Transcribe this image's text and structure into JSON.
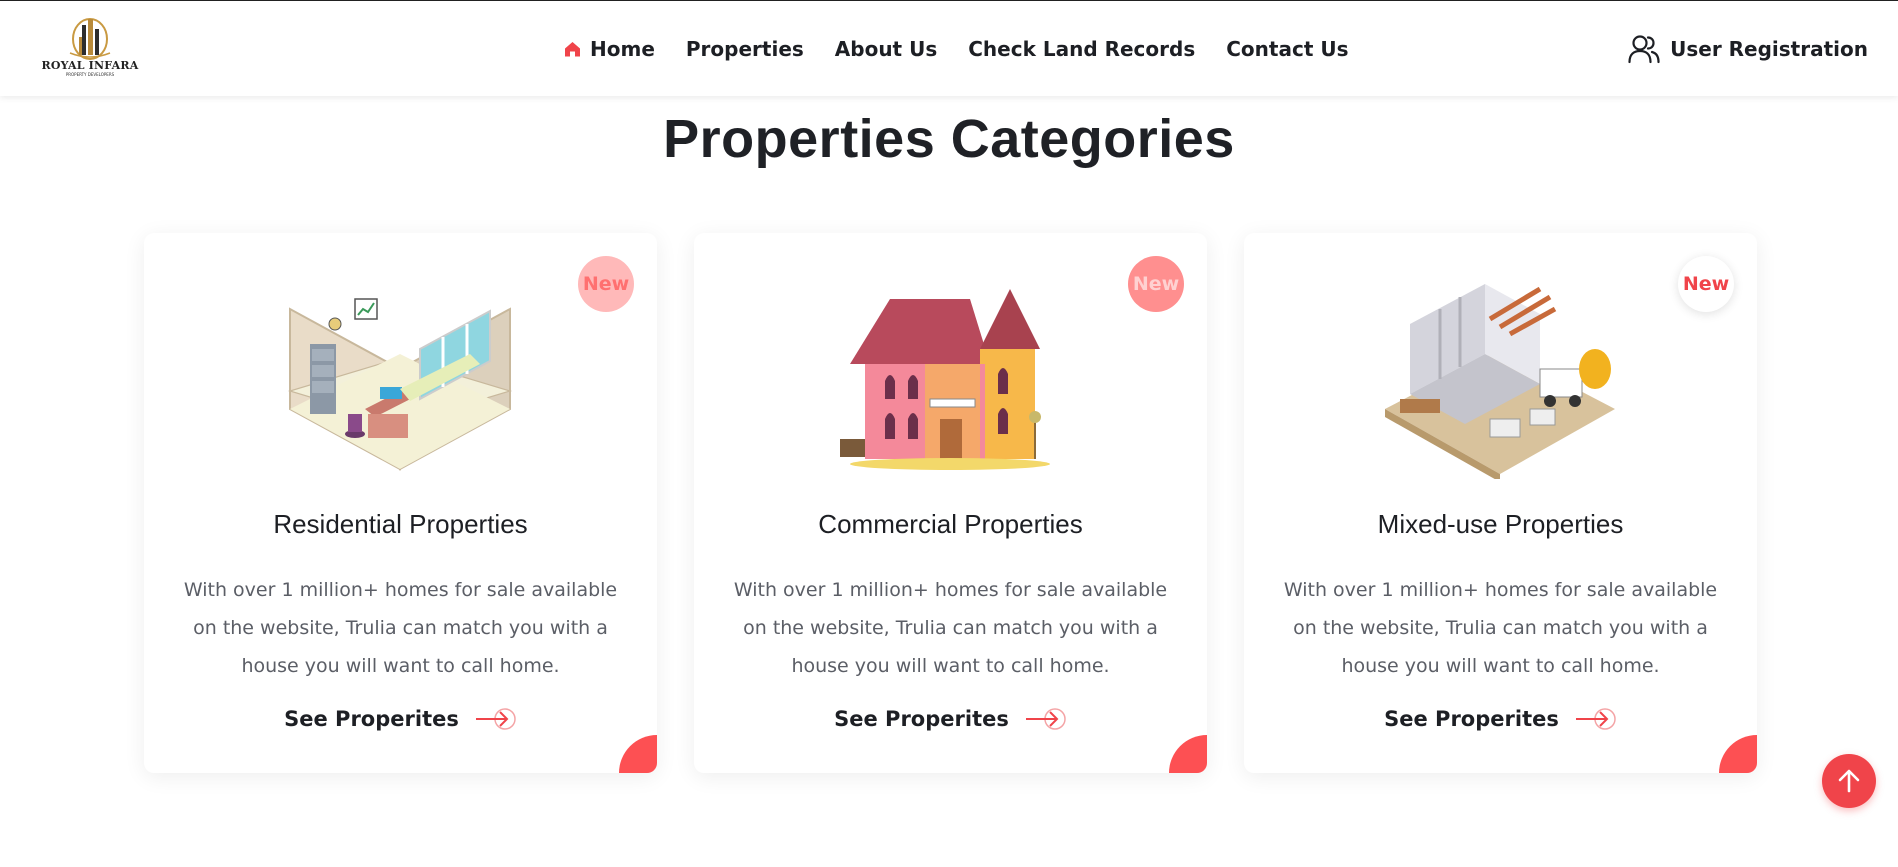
{
  "header": {
    "logo_text": "ROYAL INFARA",
    "logo_subtext": "PROPERTY DEVELOPERS",
    "nav": [
      {
        "label": "Home",
        "icon": "home-icon",
        "active": true
      },
      {
        "label": "Properties"
      },
      {
        "label": "About Us"
      },
      {
        "label": "Check Land Records"
      },
      {
        "label": "Contact Us"
      }
    ],
    "user_registration": "User Registration",
    "user_icon": "user-group-icon"
  },
  "section": {
    "title": "Properties Categories"
  },
  "cards": [
    {
      "badge": "New",
      "title": "Residential Properties",
      "description": "With over 1 million+ homes for sale available on the website, Trulia can match you with a house you will want to call home.",
      "link": "See Properites",
      "illustration": "isometric-office-room"
    },
    {
      "badge": "New",
      "title": "Commercial Properties",
      "description": "With over 1 million+ homes for sale available on the website, Trulia can match you with a house you will want to call home.",
      "link": "See Properites",
      "illustration": "pink-house"
    },
    {
      "badge": "New",
      "title": "Mixed-use Properties",
      "description": "With over 1 million+ homes for sale available on the website, Trulia can match you with a house you will want to call home.",
      "link": "See Properites",
      "illustration": "construction-site"
    }
  ],
  "colors": {
    "accent": "#fd5053",
    "badge_light": "#ffb9b9",
    "badge_mid": "#ff8f8f",
    "text_dark": "#1d1f24",
    "text_muted": "#5b5e66"
  },
  "scroll_to_top_icon": "arrow-up-icon"
}
